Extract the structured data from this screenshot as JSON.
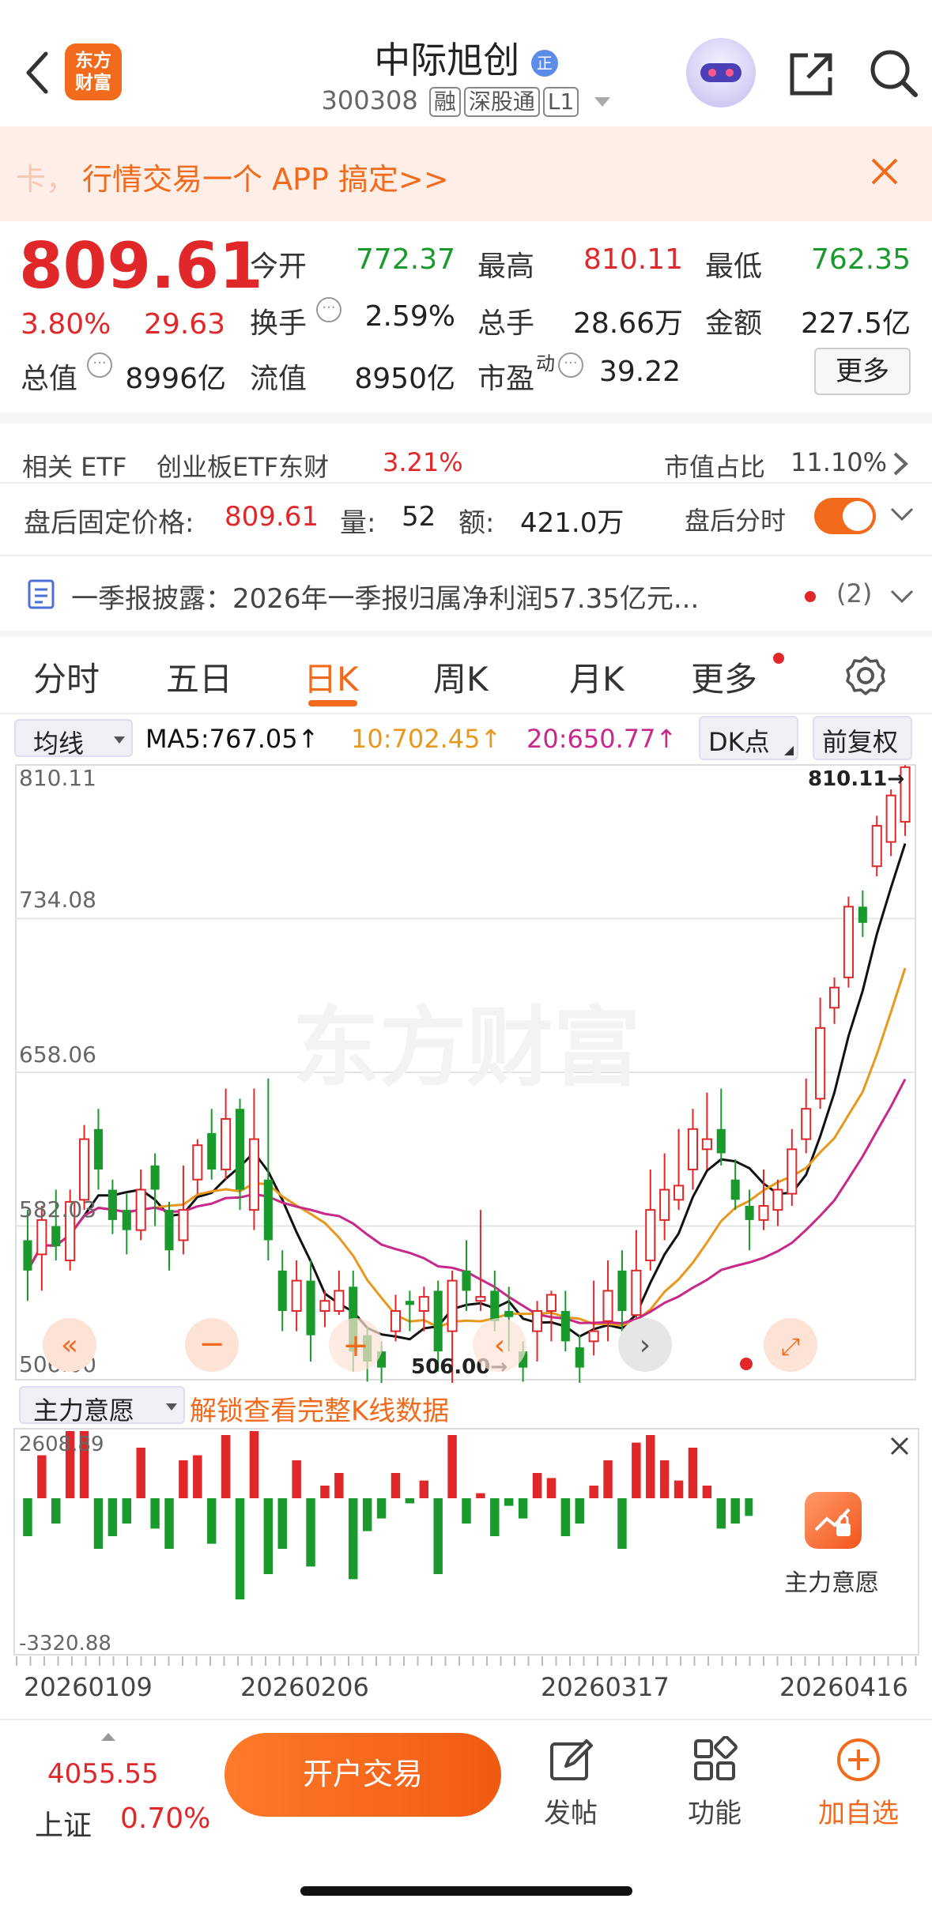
{
  "header": {
    "stock_name": "中际旭创",
    "code": "300308",
    "tags": [
      "融",
      "深股通",
      "L1"
    ],
    "logo_text": "东方\n财富",
    "logo_line1": "东方",
    "logo_line2": "财富",
    "verified_badge": "正"
  },
  "banner": {
    "text": "行情交易一个 APP 搞定>>",
    "prefix": "卡，"
  },
  "quote": {
    "price": "809.61",
    "change_pct": "3.80%",
    "change_amt": "29.63",
    "open_label": "今开",
    "open": "772.37",
    "high_label": "最高",
    "high": "810.11",
    "low_label": "最低",
    "low": "762.35",
    "turnover_label": "换手",
    "turnover": "2.59%",
    "volume_label": "总手",
    "volume": "28.66万",
    "amount_label": "金额",
    "amount": "227.5亿",
    "mktcap_label": "总值",
    "mktcap": "8996亿",
    "float_label": "流值",
    "float": "8950亿",
    "pe_label": "市盈",
    "pe_sup": "动",
    "pe": "39.22",
    "more_button": "更多"
  },
  "etf": {
    "label": "相关 ETF",
    "name": "创业板ETF东财",
    "pct": "3.21%",
    "weight_label": "市值占比",
    "weight": "11.10%"
  },
  "after_hours": {
    "price_label": "盘后固定价格:",
    "price": "809.61",
    "vol_label": "量:",
    "vol": "52",
    "amt_label": "额:",
    "amt": "421.0万",
    "toggle_label": "盘后分时"
  },
  "news": {
    "text": "一季报披露：2026年一季报归属净利润57.35亿元...",
    "count": "(2)"
  },
  "tabs": [
    "分时",
    "五日",
    "日K",
    "周K",
    "月K",
    "更多"
  ],
  "active_tab": "日K",
  "ma_bar": {
    "select": "均线",
    "ma5": "MA5:767.05↑",
    "ma10": "10:702.45↑",
    "ma20": "20:650.77↑",
    "dk": "DK点",
    "adjust": "前复权"
  },
  "kline_axis": {
    "top": "810.11",
    "l2": "734.08",
    "l3": "658.06",
    "l4": "582.03",
    "bottom": "506.00",
    "high_marker": "810.11→",
    "low_marker": "506.00→",
    "watermark": "东方财富"
  },
  "indicator": {
    "select": "主力意愿",
    "unlock": "解锁查看完整K线数据",
    "max": "2608.89",
    "min": "-3320.88",
    "side_label": "主力意愿"
  },
  "dates": [
    "20260109",
    "20260206",
    "20260317",
    "20260416"
  ],
  "bottom": {
    "index_value": "4055.55",
    "index_name": "上证",
    "index_pct": "0.70%",
    "trade_button": "开户交易",
    "post": "发帖",
    "func": "功能",
    "add": "加自选"
  },
  "colors": {
    "up": "#e0282b",
    "down": "#1a9a2c",
    "accent": "#f26a1b",
    "ma5": "#111111",
    "ma10": "#e8981c",
    "ma20": "#c8288a"
  },
  "chart_data": {
    "type": "candlestick",
    "ylim": [
      506.0,
      810.11
    ],
    "candles": [
      [
        575,
        560,
        590,
        545
      ],
      [
        568,
        585,
        592,
        550
      ],
      [
        582,
        572,
        600,
        565
      ],
      [
        565,
        594,
        600,
        560
      ],
      [
        595,
        625,
        632,
        590
      ],
      [
        630,
        610,
        640,
        600
      ],
      [
        600,
        585,
        605,
        578
      ],
      [
        590,
        580,
        598,
        568
      ],
      [
        580,
        600,
        610,
        575
      ],
      [
        612,
        600,
        618,
        582
      ],
      [
        590,
        570,
        594,
        560
      ],
      [
        575,
        590,
        612,
        568
      ],
      [
        605,
        622,
        625,
        598
      ],
      [
        628,
        610,
        640,
        605
      ],
      [
        610,
        635,
        650,
        605
      ],
      [
        640,
        600,
        645,
        590
      ],
      [
        590,
        625,
        650,
        580
      ],
      [
        605,
        575,
        655,
        565
      ],
      [
        560,
        540,
        570,
        530
      ],
      [
        540,
        555,
        565,
        530
      ],
      [
        555,
        528,
        565,
        515
      ],
      [
        540,
        545,
        550,
        532
      ],
      [
        540,
        550,
        560,
        538
      ],
      [
        552,
        520,
        560,
        510
      ],
      [
        528,
        515,
        532,
        505
      ],
      [
        520,
        512,
        525,
        498
      ],
      [
        530,
        540,
        548,
        525
      ],
      [
        545,
        543,
        550,
        530
      ],
      [
        540,
        547,
        552,
        530
      ],
      [
        550,
        520,
        555,
        510
      ],
      [
        530,
        555,
        560,
        500
      ],
      [
        560,
        550,
        575,
        540
      ],
      [
        545,
        547,
        590,
        540
      ],
      [
        550,
        535,
        560,
        530
      ],
      [
        540,
        537,
        552,
        520
      ],
      [
        520,
        512,
        525,
        505
      ],
      [
        530,
        540,
        545,
        515
      ],
      [
        540,
        548,
        550,
        525
      ],
      [
        540,
        525,
        550,
        520
      ],
      [
        522,
        512,
        528,
        500
      ],
      [
        525,
        530,
        555,
        518
      ],
      [
        535,
        550,
        565,
        525
      ],
      [
        560,
        540,
        570,
        530
      ],
      [
        538,
        560,
        580,
        520
      ],
      [
        565,
        590,
        610,
        560
      ],
      [
        585,
        600,
        618,
        575
      ],
      [
        595,
        602,
        630,
        590
      ],
      [
        610,
        630,
        640,
        600
      ],
      [
        620,
        625,
        648,
        610
      ],
      [
        630,
        618,
        650,
        612
      ],
      [
        605,
        595,
        615,
        590
      ],
      [
        592,
        585,
        600,
        570
      ],
      [
        585,
        592,
        610,
        580
      ],
      [
        590,
        600,
        605,
        582
      ],
      [
        598,
        620,
        630,
        592
      ],
      [
        625,
        640,
        655,
        618
      ],
      [
        645,
        680,
        695,
        640
      ],
      [
        690,
        700,
        705,
        682
      ],
      [
        705,
        740,
        745,
        700
      ],
      [
        740,
        732,
        748,
        725
      ],
      [
        760,
        780,
        785,
        755
      ],
      [
        772,
        795,
        798,
        765
      ],
      [
        782,
        809,
        810,
        775
      ]
    ]
  }
}
